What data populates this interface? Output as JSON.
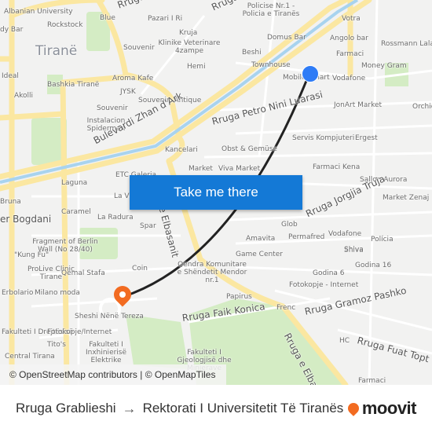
{
  "map": {
    "labels": [
      "Albanian University",
      "Rockstock",
      "Blue",
      "Pazari I Ri",
      "Kruja",
      "Souvenir",
      "Klinike Veterinare 4zampe",
      "Tiranë",
      "Hemi",
      "Ideal",
      "Bashkia Tiranë",
      "Aroma Kafe",
      "JYSK",
      "Akolli",
      "Souvenir, Antique",
      "Souvenir",
      "Instalacion Spiderman",
      "Bulevardi Zhan d'Ark",
      "Kancelari",
      "Market",
      "Policise Nr.1 - Policia e Tiranës",
      "Votra",
      "Domus Bar",
      "Angolo bar",
      "Rossmann Lala",
      "Beshi",
      "Farmaci",
      "Townhouse",
      "Money Gram",
      "Mobile Smart",
      "Vodafone",
      "JonArt Market",
      "Orchid",
      "Rruga Petro Nini Luarasi",
      "Servis Kompjuteri",
      "Ergest",
      "Obst & Gemüse",
      "Viva Market",
      "Farmaci Kena",
      "Sallon Aurora",
      "Laguna",
      "ETC Galeria",
      "Market Zenaj",
      "Bruna",
      "Caramel",
      "La Radura",
      "La Vi",
      "Spar",
      "er Bogdani",
      "Rruga Jorgjia Truja",
      "Glob",
      "Permafred",
      "Vodafone",
      "Polícia",
      "Amavita",
      "Fragment of Berlin Wall (No 28/40)",
      "Shiva",
      "Game Center",
      "\"Kung Fu\"",
      "Coin",
      "Godina 16",
      "Qendra Komunitare e Shëndetit Mendor nr.1",
      "ProLive Clinic Tirane",
      "Qemal Stafa",
      "Godina 6",
      "Erbolario",
      "Milano moda",
      "Fotokopje - Internet",
      "Papirus",
      "Frenc",
      "Rruga Gramoz Pashko",
      "Sheshi Nënë Tereza",
      "Rruga Faik Konica",
      "Rruga e Elbasanit",
      "Fakulteti I Drejtësisë",
      "Fotokopje/Internet",
      "Fakulteti I Inxhinierisë Elektrike",
      "Tito's",
      "HC",
      "Rruga Fuat Topt",
      "Fakulteti I Gjeologjisë dhe Minierave",
      "Central Tirana",
      "Farmaci",
      "Rruga e Elbasanit",
      "dy Bar",
      "Rruga",
      "Rruga",
      "Shiva"
    ],
    "origin_color": "#2f7cf6",
    "destination_color": "#f26b21",
    "route_color": "#222222"
  },
  "cta": {
    "label": "Take me there"
  },
  "attribution": "© OpenStreetMap contributors | © OpenMapTiles",
  "footer": {
    "from": "Rruga Grablieshi",
    "arrow": "→",
    "to": "Rektorati I Universitetit Të Tiranës",
    "logo": "moovit"
  }
}
